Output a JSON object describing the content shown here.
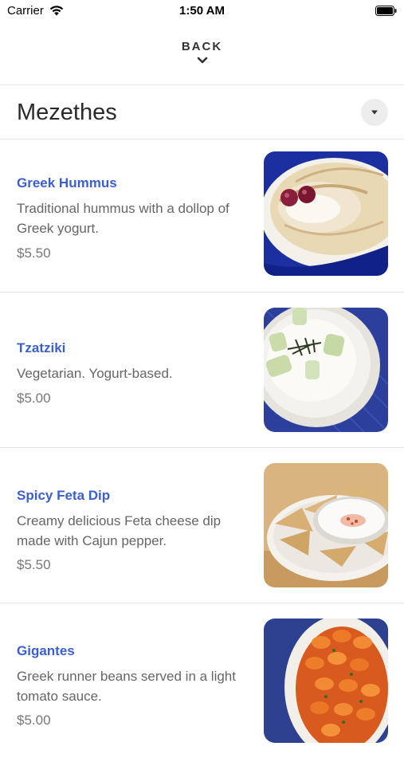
{
  "status_bar": {
    "carrier": "Carrier",
    "time": "1:50 AM",
    "wifi_icon": "wifi-icon",
    "battery_icon": "battery-icon"
  },
  "nav": {
    "back_label": "BACK",
    "back_icon": "chevron-down-icon"
  },
  "section": {
    "title": "Mezethes",
    "dropdown_icon": "caret-down-icon"
  },
  "colors": {
    "item_name": "#3b5fd0",
    "description": "#666666",
    "price": "#777777",
    "divider": "#e7e7e7"
  },
  "items": [
    {
      "name": "Greek Hummus",
      "description": "Traditional hummus with a dollop of Greek yogurt.",
      "price": "$5.50",
      "image": "hummus-photo"
    },
    {
      "name": "Tzatziki",
      "description": "Vegetarian. Yogurt-based.",
      "price": "$5.00",
      "image": "tzatziki-photo"
    },
    {
      "name": "Spicy Feta Dip",
      "description": "Creamy delicious Feta cheese dip made with Cajun pepper.",
      "price": "$5.50",
      "image": "feta-dip-photo"
    },
    {
      "name": "Gigantes",
      "description": "Greek runner beans served in a light tomato sauce.",
      "price": "$5.00",
      "image": "gigantes-photo"
    }
  ]
}
